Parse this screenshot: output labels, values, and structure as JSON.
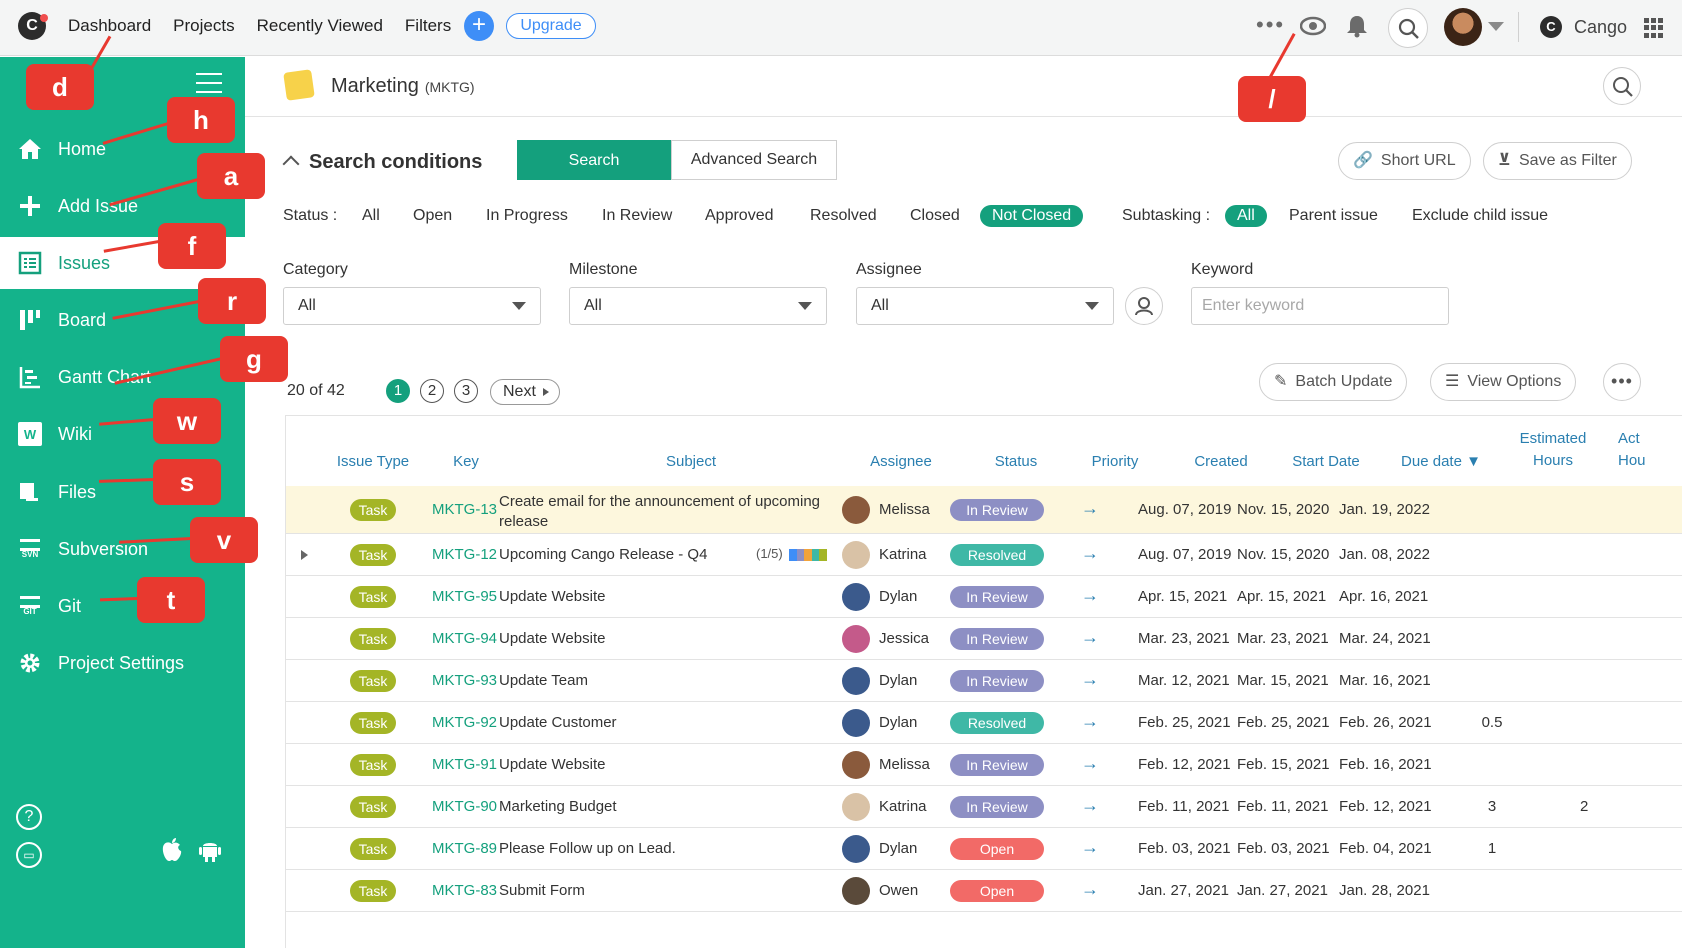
{
  "topbar": {
    "logo_letter": "C",
    "nav": [
      "Dashboard",
      "Projects",
      "Recently Viewed",
      "Filters"
    ],
    "add_symbol": "+",
    "upgrade_label": "Upgrade",
    "more_icon": "more-horizontal-icon",
    "watch_icon": "eye-icon",
    "notifications_icon": "bell-icon",
    "search_icon": "search-icon",
    "space_logo_letter": "C",
    "space_name": "Cango",
    "apps_icon": "grid-icon"
  },
  "sidebar": {
    "items": [
      {
        "label": "Home",
        "icon": "home-icon"
      },
      {
        "label": "Add Issue",
        "icon": "plus-icon"
      },
      {
        "label": "Issues",
        "icon": "list-icon",
        "active": true
      },
      {
        "label": "Board",
        "icon": "board-icon"
      },
      {
        "label": "Gantt Chart",
        "icon": "gantt-icon"
      },
      {
        "label": "Wiki",
        "icon": "wiki-icon",
        "icon_text": "W"
      },
      {
        "label": "Files",
        "icon": "folder-icon"
      },
      {
        "label": "Subversion",
        "icon": "svn-icon",
        "icon_text": "SVN"
      },
      {
        "label": "Git",
        "icon": "git-icon",
        "icon_text": "GIT"
      },
      {
        "label": "Project Settings",
        "icon": "gear-icon"
      }
    ],
    "help_symbol": "?",
    "chat_symbol": "▭"
  },
  "shortcuts": [
    "d",
    "h",
    "a",
    "f",
    "r",
    "g",
    "w",
    "s",
    "v",
    "t",
    "/"
  ],
  "project": {
    "name": "Marketing",
    "key": "(MKTG)"
  },
  "search": {
    "title": "Search conditions",
    "tab_search": "Search",
    "tab_advanced": "Advanced Search",
    "short_url": "Short URL",
    "save_filter": "Save as Filter",
    "status_label": "Status :",
    "status_options": [
      "All",
      "Open",
      "In Progress",
      "In Review",
      "Approved",
      "Resolved",
      "Closed",
      "Not Closed"
    ],
    "status_selected": "Not Closed",
    "subtask_label": "Subtasking :",
    "subtask_options": [
      "All",
      "Parent issue",
      "Exclude child issue"
    ],
    "subtask_selected": "All",
    "category_label": "Category",
    "category_value": "All",
    "milestone_label": "Milestone",
    "milestone_value": "All",
    "assignee_label": "Assignee",
    "assignee_value": "All",
    "keyword_label": "Keyword",
    "keyword_placeholder": "Enter keyword"
  },
  "pager": {
    "range_text": "20 of 42",
    "pages": [
      "1",
      "2",
      "3"
    ],
    "current": "1",
    "next_label": "Next",
    "batch_update": "Batch Update",
    "view_options": "View Options",
    "more_symbol": "•••"
  },
  "table": {
    "headers": [
      "Issue Type",
      "Key",
      "Subject",
      "Assignee",
      "Status",
      "Priority",
      "Created",
      "Start Date",
      "Due date ▼",
      "Estimated Hours",
      "Actual Hours"
    ],
    "header_actual_visible": [
      "Act",
      "Hou"
    ],
    "rows": [
      {
        "type": "Task",
        "key": "MKTG-13",
        "subject": "Create email for the announcement of upcoming release",
        "subtask": "",
        "assignee": "Melissa",
        "status": "In Review",
        "created": "Aug. 07, 2019",
        "start": "Nov. 15, 2020",
        "due": "Jan. 19, 2022",
        "est": "",
        "actual": "",
        "highlight": true
      },
      {
        "type": "Task",
        "key": "MKTG-12",
        "subject": "Upcoming Cango Release - Q4",
        "subtask": "(1/5)",
        "assignee": "Katrina",
        "status": "Resolved",
        "created": "Aug. 07, 2019",
        "start": "Nov. 15, 2020",
        "due": "Jan. 08, 2022",
        "est": "",
        "actual": "",
        "expandable": true
      },
      {
        "type": "Task",
        "key": "MKTG-95",
        "subject": "Update Website",
        "subtask": "",
        "assignee": "Dylan",
        "status": "In Review",
        "created": "Apr. 15, 2021",
        "start": "Apr. 15, 2021",
        "due": "Apr. 16, 2021",
        "est": "",
        "actual": ""
      },
      {
        "type": "Task",
        "key": "MKTG-94",
        "subject": "Update Website",
        "subtask": "",
        "assignee": "Jessica",
        "status": "In Review",
        "created": "Mar. 23, 2021",
        "start": "Mar. 23, 2021",
        "due": "Mar. 24, 2021",
        "est": "",
        "actual": ""
      },
      {
        "type": "Task",
        "key": "MKTG-93",
        "subject": "Update Team",
        "subtask": "",
        "assignee": "Dylan",
        "status": "In Review",
        "created": "Mar. 12, 2021",
        "start": "Mar. 15, 2021",
        "due": "Mar. 16, 2021",
        "est": "",
        "actual": ""
      },
      {
        "type": "Task",
        "key": "MKTG-92",
        "subject": "Update Customer",
        "subtask": "",
        "assignee": "Dylan",
        "status": "Resolved",
        "created": "Feb. 25, 2021",
        "start": "Feb. 25, 2021",
        "due": "Feb. 26, 2021",
        "est": "0.5",
        "actual": ""
      },
      {
        "type": "Task",
        "key": "MKTG-91",
        "subject": "Update Website",
        "subtask": "",
        "assignee": "Melissa",
        "status": "In Review",
        "created": "Feb. 12, 2021",
        "start": "Feb. 15, 2021",
        "due": "Feb. 16, 2021",
        "est": "",
        "actual": ""
      },
      {
        "type": "Task",
        "key": "MKTG-90",
        "subject": "Marketing Budget",
        "subtask": "",
        "assignee": "Katrina",
        "status": "In Review",
        "created": "Feb. 11, 2021",
        "start": "Feb. 11, 2021",
        "due": "Feb. 12, 2021",
        "est": "3",
        "actual": "2"
      },
      {
        "type": "Task",
        "key": "MKTG-89",
        "subject": "Please Follow up on Lead.",
        "subtask": "",
        "assignee": "Dylan",
        "status": "Open",
        "created": "Feb. 03, 2021",
        "start": "Feb. 03, 2021",
        "due": "Feb. 04, 2021",
        "est": "1",
        "actual": ""
      },
      {
        "type": "Task",
        "key": "MKTG-83",
        "subject": "Submit Form",
        "subtask": "",
        "assignee": "Owen",
        "status": "Open",
        "created": "Jan. 27, 2021",
        "start": "Jan. 27, 2021",
        "due": "Jan. 28, 2021",
        "est": "",
        "actual": ""
      }
    ],
    "priority_icon": "arrow-right-icon"
  },
  "colors": {
    "brand_green": "#14a07d",
    "sidebar_green": "#14b38b",
    "task_badge": "#a4b526",
    "status_in_review": "#8d8fc4",
    "status_resolved": "#3fb8a6",
    "status_open": "#f26a67",
    "callout_red": "#e8392f",
    "highlight_row": "#fdf7dd"
  }
}
